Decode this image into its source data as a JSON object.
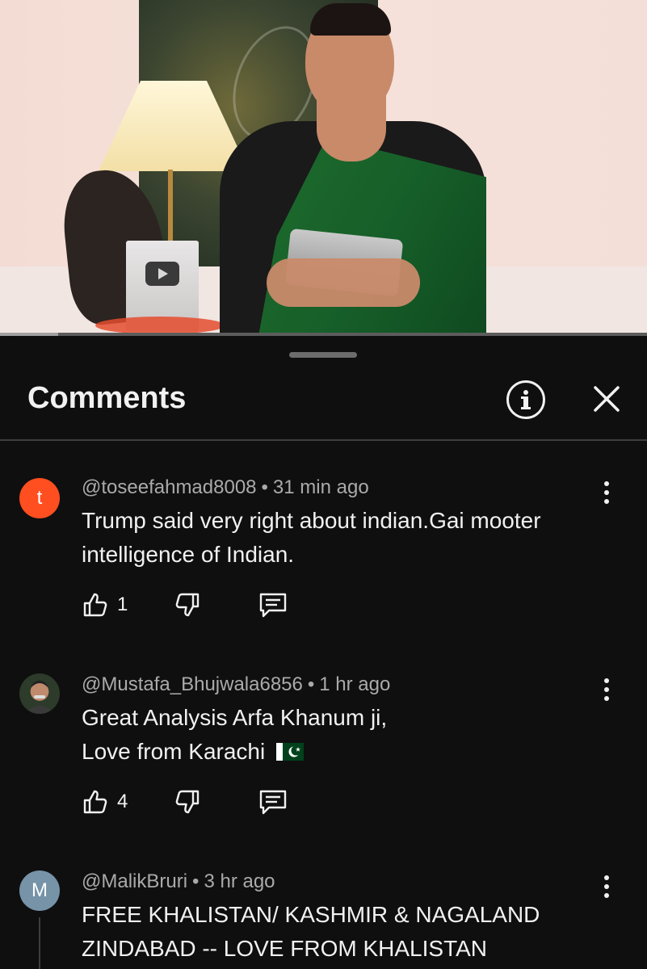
{
  "video": {
    "progress_fraction": 0.09,
    "plaque_icon": "play-button-icon"
  },
  "sheet": {
    "title": "Comments",
    "info_icon": "info-icon",
    "close_icon": "close-icon"
  },
  "comments": [
    {
      "avatar_letter": "t",
      "avatar_color": "#ff4e1f",
      "author": "@toseefahmad8008",
      "time": "31 min ago",
      "text_line1": "Trump said very right about indian.Gai mooter",
      "text_line2": "intelligence of Indian.",
      "likes": "1"
    },
    {
      "avatar_letter": "",
      "avatar_color": "#2d3b2a",
      "author": "@Mustafa_Bhujwala6856",
      "time": "1 hr ago",
      "text_line1": "Great Analysis Arfa Khanum ji,",
      "text_line2": "Love from Karachi",
      "text_emoji": "pakistan-flag-emoji",
      "likes": "4"
    },
    {
      "avatar_letter": "M",
      "avatar_color": "#7693a8",
      "author": "@MalikBruri",
      "time": "3 hr ago",
      "text_line1": "FREE KHALISTAN/ KASHMIR & NAGALAND",
      "text_line2": "ZINDABAD -- LOVE FROM KHALISTAN"
    }
  ],
  "separator": "•",
  "colors": {
    "background": "#0f0f0f",
    "text_primary": "#f1f1f1",
    "text_secondary": "#aaaaaa"
  }
}
